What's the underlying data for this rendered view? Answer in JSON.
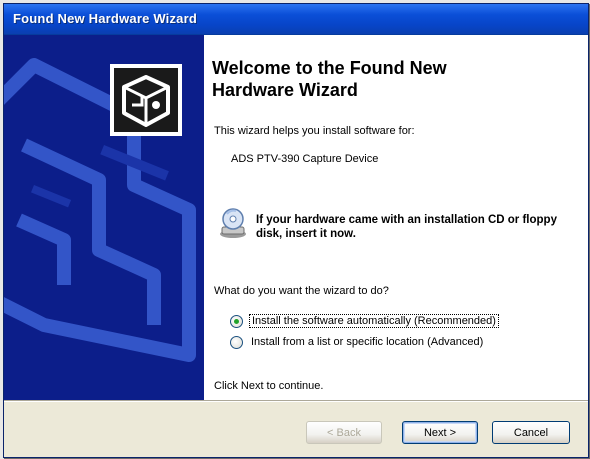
{
  "window": {
    "title": "Found New Hardware Wizard"
  },
  "icons": {
    "wizard": "hardware-wizard-icon",
    "cd": "installation-cd-icon",
    "radio_selected": "radio-selected",
    "radio_unselected": "radio-unselected"
  },
  "colors": {
    "title_bar": "#0b4fd8",
    "side_panel": "#0c1e8a",
    "dialog_face": "#ece9d8",
    "radio_dot": "#22a22a"
  },
  "content": {
    "heading": "Welcome to the Found New Hardware Wizard",
    "intro": "This wizard helps you install software for:",
    "device_name": "ADS PTV-390 Capture Device",
    "cd_note": "If your hardware came with an installation CD or floppy disk, insert it now.",
    "question": "What do you want the wizard to do?",
    "options": [
      {
        "label": "Install the software automatically (Recommended)",
        "selected": true
      },
      {
        "label": "Install from a list or specific location (Advanced)",
        "selected": false
      }
    ],
    "continue_text": "Click Next to continue."
  },
  "buttons": {
    "back": "< Back",
    "next": "Next >",
    "cancel": "Cancel"
  }
}
